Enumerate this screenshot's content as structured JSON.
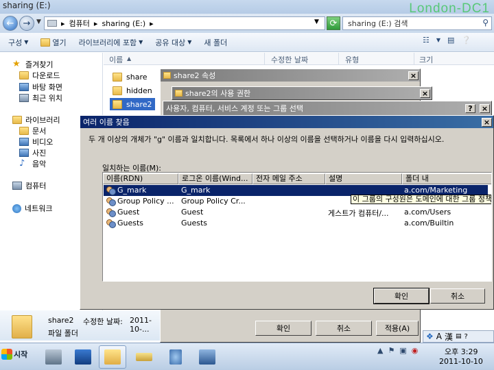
{
  "window_title": "sharing (E:)",
  "server_label": "London-DC1",
  "address": {
    "segments": [
      "컴퓨터",
      "sharing (E:)"
    ],
    "search_placeholder": "sharing (E:) 검색"
  },
  "toolbar": {
    "organize": "구성",
    "open": "열기",
    "include_library": "라이브러리에 포함",
    "share_with": "공유 대상",
    "new_folder": "새 폴더"
  },
  "nav": {
    "favorites": "즐겨찾기",
    "downloads": "다운로드",
    "desktop": "바탕 화면",
    "recent": "최근 위치",
    "libraries": "라이브러리",
    "documents": "문서",
    "videos": "비디오",
    "pictures": "사진",
    "music": "음악",
    "computer": "컴퓨터",
    "network": "네트워크"
  },
  "columns": {
    "name": "이름",
    "modified": "수정한 날짜",
    "type": "유형",
    "size": "크기"
  },
  "files": [
    "share",
    "hidden",
    "share2"
  ],
  "details": {
    "name": "share2",
    "modified_label": "수정한 날짜:",
    "modified_value": "2011-10-...",
    "type": "파일 폴더"
  },
  "dialogs": {
    "properties_title": "share2 속성",
    "permissions_title": "share2의 사용 권한",
    "select_title": "사용자, 컴퓨터, 서비스 계정 또는 그룹 선택",
    "properties_ok": "확인",
    "properties_cancel": "취소",
    "properties_apply": "적용(A)"
  },
  "multi": {
    "title": "여러 이름 찾음",
    "description": "두 개 이상의 개체가 \"g\" 이름과 일치합니다. 목록에서 하나 이상의 이름을 선택하거나 이름을 다시 입력하십시오.",
    "match_label": "일치하는 이름(M):",
    "headers": [
      "이름(RDN)",
      "로그온 이름(Wind...",
      "전자 메일 주소",
      "설명",
      "폴더 내"
    ],
    "rows": [
      {
        "rdn": "G_mark",
        "logon": "G_mark",
        "email": "",
        "desc": "",
        "folder": "a.com/Marketing"
      },
      {
        "rdn": "Group Policy ...",
        "logon": "Group Policy Cr...",
        "email": "",
        "desc": "",
        "folder": ""
      },
      {
        "rdn": "Guest",
        "logon": "Guest",
        "email": "",
        "desc": "게스트가 컴퓨터/...",
        "folder": "a.com/Users"
      },
      {
        "rdn": "Guests",
        "logon": "Guests",
        "email": "",
        "desc": "",
        "folder": "a.com/Builtin"
      }
    ],
    "tooltip": "이 그룹의 구성원은 도메인에 대한 그룹 정책을 편",
    "ok": "확인",
    "cancel": "취소"
  },
  "langbar": {
    "mode": "A",
    "hanja": "漢"
  },
  "taskbar": {
    "start": "시작"
  },
  "clock": {
    "time": "오후 3:29",
    "date": "2011-10-10"
  },
  "colors": {
    "selection": "#0a246a",
    "server_label": "#58c878"
  }
}
